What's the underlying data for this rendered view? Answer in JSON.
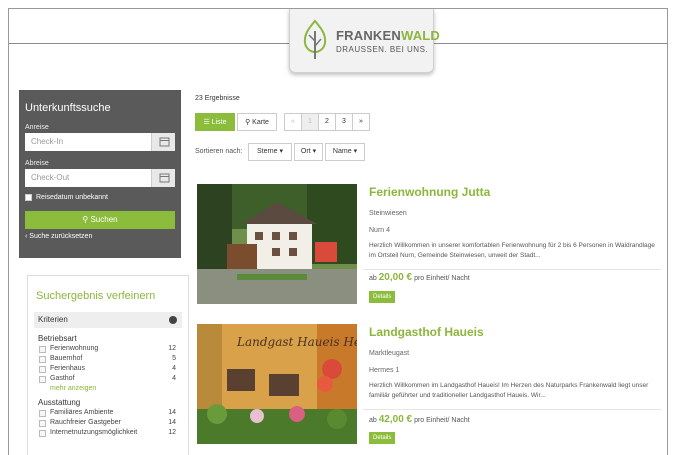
{
  "brand": {
    "name_part1": "FRANKEN",
    "name_part2": "WALD",
    "tagline": "DRAUSSEN. BEI UNS."
  },
  "search": {
    "title": "Unterkunftssuche",
    "arrival_label": "Anreise",
    "arrival_placeholder": "Check-In",
    "departure_label": "Abreise",
    "departure_placeholder": "Check-Out",
    "unknown_date_label": "Reisedatum unbekannt",
    "submit_label": "Suchen",
    "reset_label": "Suche zurücksetzen"
  },
  "refine": {
    "title": "Suchergebnis verfeinern",
    "criteria_label": "Kriterien",
    "groups": [
      {
        "title": "Betriebsart",
        "items": [
          {
            "label": "Ferienwohnung",
            "count": "12"
          },
          {
            "label": "Bauernhof",
            "count": "5"
          },
          {
            "label": "Ferienhaus",
            "count": "4"
          },
          {
            "label": "Gasthof",
            "count": "4"
          }
        ],
        "more": "mehr anzeigen"
      },
      {
        "title": "Ausstattung",
        "items": [
          {
            "label": "Familiäres Ambiente",
            "count": "14"
          },
          {
            "label": "Rauchfreier Gastgeber",
            "count": "14"
          },
          {
            "label": "Internetnutzungsmöglichkeit",
            "count": "12"
          }
        ]
      }
    ]
  },
  "results": {
    "count_label": "23 Ergebnisse",
    "view_list": "Liste",
    "view_map": "Karte",
    "pagination": [
      "«",
      "1",
      "2",
      "3",
      "»"
    ],
    "sort_label": "Sortieren nach:",
    "sort_options": [
      "Sterne",
      "Ort",
      "Name"
    ],
    "listings": [
      {
        "title": "Ferienwohnung Jutta",
        "town": "Steinwiesen",
        "street": "Nurn 4",
        "description": "Herzlich Willkommen in unserer komfortablen Ferienwohnung für 2 bis 6 Personen in Waldrandlage im Ortsteil Nurn, Gemeinde Steinwiesen, unweit der Stadt...",
        "price_prefix": "ab",
        "price": "20,00 €",
        "price_suffix": "pro Einheit/ Nacht",
        "details_label": "Details"
      },
      {
        "title": "Landgasthof Haueis",
        "town": "Marktleugast",
        "street": "Hermes 1",
        "description": "Herzlich Willkommen im Landgasthof Haueis! Im Herzen des Naturparks Frankenwald liegt unser familiär geführter und traditioneller Landgasthof Haueis. Wir...",
        "price_prefix": "ab",
        "price": "42,00 €",
        "price_suffix": "pro Einheit/ Nacht",
        "details_label": "Details",
        "sign_text": "Landgast Haueis Hermes"
      }
    ]
  },
  "colors": {
    "accent": "#8cbc3c",
    "panel": "#5a5a5a"
  }
}
